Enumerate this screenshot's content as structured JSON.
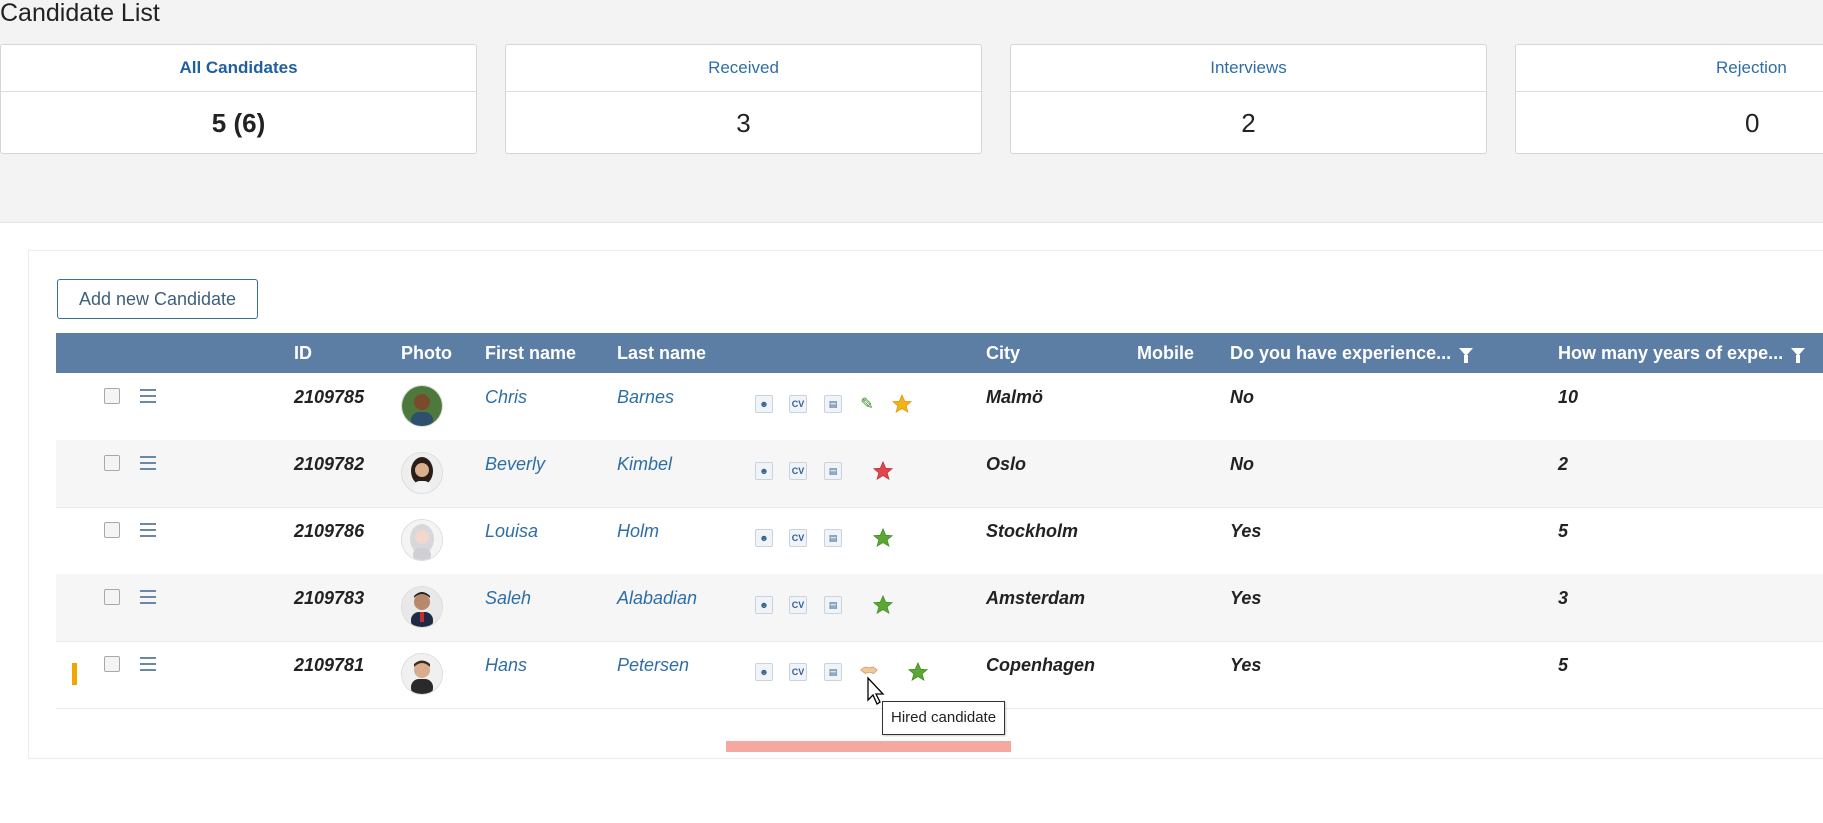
{
  "page": {
    "title": "Candidate List"
  },
  "summary": [
    {
      "label": "All Candidates",
      "value": "5 (6)",
      "active": true
    },
    {
      "label": "Received",
      "value": "3",
      "active": false
    },
    {
      "label": "Interviews",
      "value": "2",
      "active": false
    },
    {
      "label": "Rejection",
      "value": "0",
      "active": false
    }
  ],
  "toolbar": {
    "add_label": "Add new Candidate"
  },
  "grid": {
    "headers": {
      "id": "ID",
      "photo": "Photo",
      "first_name": "First name",
      "last_name": "Last name",
      "city": "City",
      "mobile": "Mobile",
      "experience": "Do you have experience...",
      "years": "How many years of expe..."
    },
    "rows": [
      {
        "id": "2109785",
        "first": "Chris",
        "last": "Barnes",
        "city": "Malmö",
        "mobile": "",
        "experience": "No",
        "years": "10",
        "star_color": "#f3b21a",
        "extra_icon": "checklist-icon"
      },
      {
        "id": "2109782",
        "first": "Beverly",
        "last": "Kimbel",
        "city": "Oslo",
        "mobile": "",
        "experience": "No",
        "years": "2",
        "star_color": "#e0474c",
        "extra_icon": ""
      },
      {
        "id": "2109786",
        "first": "Louisa",
        "last": "Holm",
        "city": "Stockholm",
        "mobile": "",
        "experience": "Yes",
        "years": "5",
        "star_color": "#5aa832",
        "extra_icon": ""
      },
      {
        "id": "2109783",
        "first": "Saleh",
        "last": "Alabadian",
        "city": "Amsterdam",
        "mobile": "",
        "experience": "Yes",
        "years": "3",
        "star_color": "#5aa832",
        "extra_icon": ""
      },
      {
        "id": "2109781",
        "first": "Hans",
        "last": "Petersen",
        "city": "Copenhagen",
        "mobile": "",
        "experience": "Yes",
        "years": "5",
        "star_color": "#5aa832",
        "extra_icon": "handshake-icon"
      }
    ]
  },
  "row_icons": {
    "profile": "profile-icon",
    "cv": "CV",
    "document": "document-icon"
  },
  "tooltip": {
    "text": "Hired candidate"
  },
  "colors": {
    "header_bg": "#5c7da4",
    "link": "#2e6ea6",
    "accent_indicator": "#f2a500",
    "progress": "#f5a8a0"
  }
}
